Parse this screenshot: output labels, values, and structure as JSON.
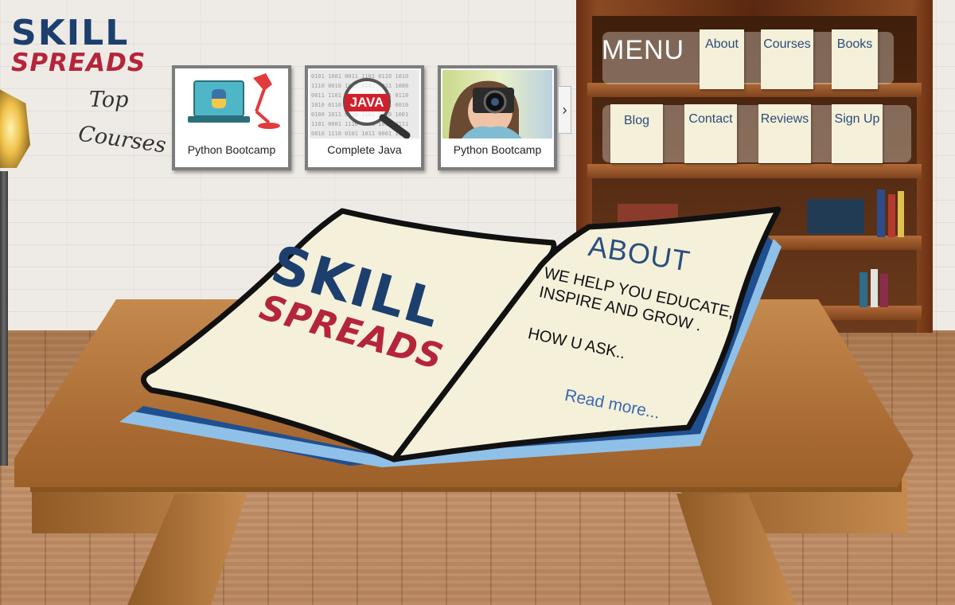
{
  "brand": {
    "line1": "SKILL",
    "line2": "SPREADS"
  },
  "top_courses": {
    "word1": "Top",
    "word2": "Courses"
  },
  "courses": [
    {
      "title": "Python Bootcamp",
      "thumb": "python-laptop-lamp"
    },
    {
      "title": "Complete Java",
      "thumb": "java-magnifier",
      "badge": "JAVA"
    },
    {
      "title": "Python Bootcamp",
      "thumb": "photographer-camera"
    }
  ],
  "carousel": {
    "next_icon": "›"
  },
  "menu": {
    "title": "MENU",
    "items": [
      "About",
      "Courses",
      "Books",
      "Blog",
      "Contact",
      "Reviews",
      "Sign Up"
    ]
  },
  "book": {
    "logo_line1": "SKILL",
    "logo_line2": "SPREADS",
    "about_title": "ABOUT",
    "about_line1": "WE HELP YOU EDUCATE,",
    "about_line2": "INSPIRE AND GROW .",
    "about_line3": "HOW U ASK..",
    "read_more": "Read more..."
  },
  "colors": {
    "brand_blue": "#1c3f6e",
    "brand_red": "#b5253a",
    "card_bg": "#f5f0da",
    "menu_text": "#2b4c78"
  }
}
